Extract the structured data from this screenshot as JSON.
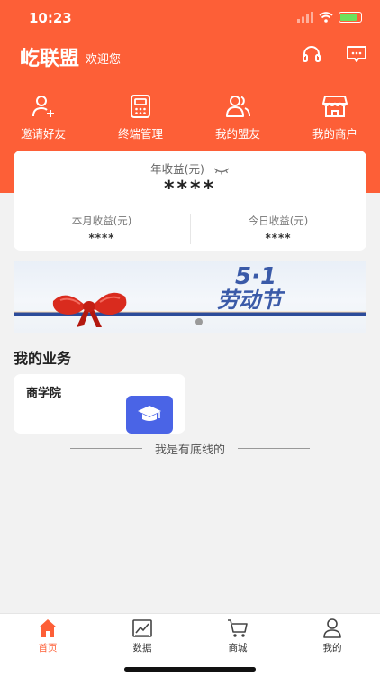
{
  "status_bar": {
    "time": "10:23"
  },
  "header": {
    "app_title": "屹联盟",
    "welcome": "欢迎您",
    "icons": [
      "headset-icon",
      "message-icon"
    ],
    "background_color": "#fd5f37"
  },
  "quick_nav": [
    {
      "label": "邀请好友",
      "icon": "add-user-icon"
    },
    {
      "label": "终端管理",
      "icon": "terminal-icon"
    },
    {
      "label": "我的盟友",
      "icon": "allies-icon"
    },
    {
      "label": "我的商户",
      "icon": "store-icon"
    }
  ],
  "earnings": {
    "year_label": "年收益(元)",
    "year_value": "****",
    "month_label": "本月收益(元)",
    "month_value": "****",
    "today_label": "今日收益(元)",
    "today_value": "****",
    "eye_icon": "eye-closed-icon"
  },
  "banner": {
    "text": "5·1劳动节"
  },
  "business": {
    "section_title": "我的业务",
    "items": [
      {
        "label": "商学院",
        "icon": "graduation-cap-icon",
        "icon_bg": "#4a64e6"
      }
    ]
  },
  "footer_note": "我是有底线的",
  "tabbar": {
    "active_color": "#fd5f37",
    "tabs": [
      {
        "label": "首页",
        "icon": "home-icon",
        "active": true
      },
      {
        "label": "数据",
        "icon": "chart-icon",
        "active": false
      },
      {
        "label": "商城",
        "icon": "cart-icon",
        "active": false
      },
      {
        "label": "我的",
        "icon": "user-icon",
        "active": false
      }
    ]
  }
}
